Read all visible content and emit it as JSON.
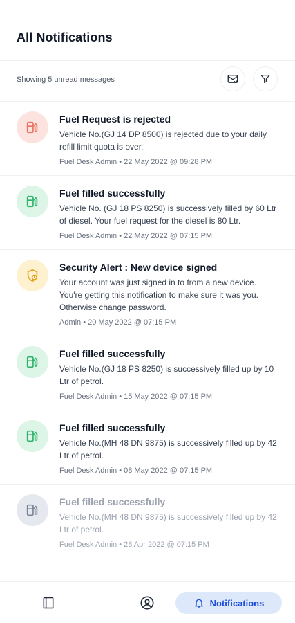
{
  "header": {
    "title": "All Notifications"
  },
  "subbar": {
    "count_text": "Showing 5 unread messages",
    "mail_icon": "mail-check-icon",
    "filter_icon": "filter-icon"
  },
  "colors": {
    "red_bg": "#fde3df",
    "red_fg": "#e8735f",
    "green_bg": "#dcf5e7",
    "green_fg": "#2fb26a",
    "yellow_bg": "#fdf1cf",
    "yellow_fg": "#e5a21a",
    "gray_bg": "#e5e8ee",
    "gray_fg": "#7b8496",
    "accent": "#1d4ed8"
  },
  "notifications": [
    {
      "title": "Fuel Request is rejected",
      "message": "Vehicle No.(GJ 14 DP 8500) is rejected due to your daily refill limit quota is over.",
      "meta": "Fuel Desk Admin • 22 May 2022 @ 09:28 PM",
      "icon": "fuel-pump-icon",
      "tone": "red"
    },
    {
      "title": "Fuel filled successfully",
      "message": "Vehicle No. (GJ 18 PS 8250) is successively filled by 60 Ltr of diesel. Your fuel request for the diesel is 80 Ltr.",
      "meta": "Fuel Desk Admin • 22 May 2022 @ 07:15 PM",
      "icon": "fuel-pump-icon",
      "tone": "green"
    },
    {
      "title": "Security Alert : New device signed",
      "message": "Your account was just signed in to from a new device. You're getting this notification to make sure it was you. Otherwise change password.",
      "meta": "Admin • 20 May 2022 @ 07:15 PM",
      "icon": "shield-alert-icon",
      "tone": "yellow"
    },
    {
      "title": "Fuel filled successfully",
      "message": "Vehicle No.(GJ 18 PS 8250) is successively filled up by 10 Ltr of petrol.",
      "meta": "Fuel Desk Admin • 15 May 2022 @ 07:15 PM",
      "icon": "fuel-pump-icon",
      "tone": "green"
    },
    {
      "title": "Fuel filled successfully",
      "message": "Vehicle No.(MH 48 DN 9875) is successively filled up by 42 Ltr of petrol.",
      "meta": "Fuel Desk Admin • 08 May 2022 @ 07:15 PM",
      "icon": "fuel-pump-icon",
      "tone": "green"
    },
    {
      "title": "Fuel filled successfully",
      "message": "Vehicle No.(MH 48 DN 9875) is successively filled up by 42 Ltr of petrol.",
      "meta": "Fuel Desk Admin • 28 Apr 2022 @ 07:15 PM",
      "icon": "fuel-pump-icon",
      "tone": "gray"
    }
  ],
  "bottom_nav": {
    "items": [
      {
        "icon": "book-icon"
      },
      {
        "icon": "user-circle-icon"
      },
      {
        "icon": "bell-icon",
        "label": "Notifications",
        "active": true
      }
    ]
  }
}
